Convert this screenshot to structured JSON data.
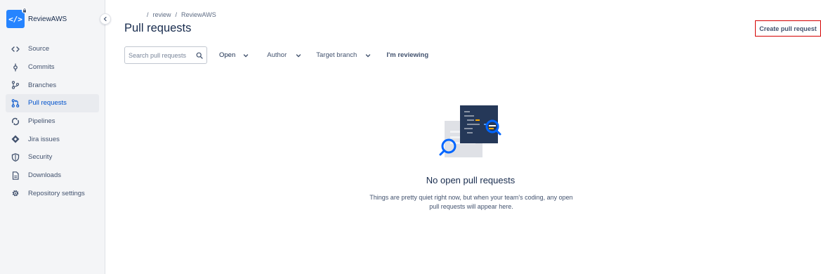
{
  "sidebar": {
    "repo_name": "ReviewAWS",
    "repo_avatar_glyph": "</>",
    "items": [
      {
        "label": "Source",
        "icon": "code-icon",
        "active": false
      },
      {
        "label": "Commits",
        "icon": "commit-icon",
        "active": false
      },
      {
        "label": "Branches",
        "icon": "branch-icon",
        "active": false
      },
      {
        "label": "Pull requests",
        "icon": "pull-request-icon",
        "active": true
      },
      {
        "label": "Pipelines",
        "icon": "pipelines-icon",
        "active": false
      },
      {
        "label": "Jira issues",
        "icon": "jira-icon",
        "active": false
      },
      {
        "label": "Security",
        "icon": "shield-icon",
        "active": false
      },
      {
        "label": "Downloads",
        "icon": "file-icon",
        "active": false
      },
      {
        "label": "Repository settings",
        "icon": "gear-icon",
        "active": false
      }
    ]
  },
  "breadcrumb": {
    "sep1": "/",
    "workspace": "review",
    "sep2": "/",
    "repo": "ReviewAWS"
  },
  "header": {
    "title": "Pull requests",
    "create_button": "Create pull request"
  },
  "filters": {
    "search_placeholder": "Search pull requests",
    "state": "Open",
    "author": "Author",
    "target_branch": "Target branch",
    "reviewing": "I'm reviewing"
  },
  "empty_state": {
    "title": "No open pull requests",
    "description": "Things are pretty quiet right now, but when your team's coding, any open pull requests will appear here."
  },
  "colors": {
    "accent": "#0052cc",
    "avatar": "#2684ff",
    "sidebar_bg": "#f4f5f7",
    "highlight_border": "#d40000"
  }
}
